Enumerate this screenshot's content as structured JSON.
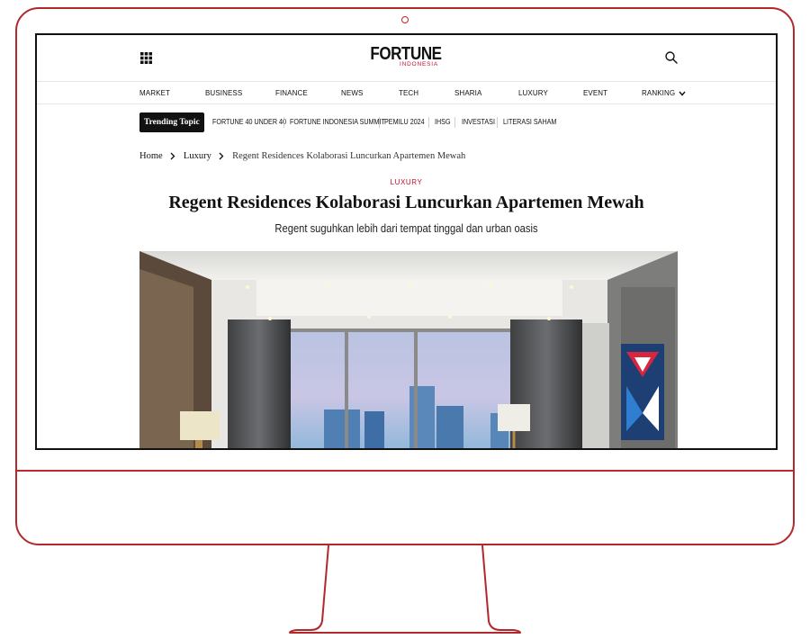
{
  "header": {
    "logo_main": "FORTUNE",
    "logo_sub": "INDONESIA",
    "menu_icon": "grid-menu-icon",
    "search_icon": "search-icon"
  },
  "nav": {
    "items": [
      "MARKET",
      "BUSINESS",
      "FINANCE",
      "NEWS",
      "TECH",
      "SHARIA",
      "LUXURY",
      "EVENT",
      "RANKING"
    ]
  },
  "trending": {
    "label": "Trending Topic",
    "items": [
      "FORTUNE 40 UNDER 40",
      "FORTUNE INDONESIA SUMMIT",
      "PEMILU 2024",
      "IHSG",
      "INVESTASI",
      "LITERASI SAHAM"
    ]
  },
  "breadcrumb": {
    "home": "Home",
    "section": "Luxury",
    "current": "Regent Residences Kolaborasi Luncurkan Apartemen Mewah"
  },
  "article": {
    "category": "LUXURY",
    "title": "Regent Residences Kolaborasi Luncurkan Apartemen Mewah",
    "subtitle": "Regent suguhkan lebih dari tempat tinggal dan urban oasis"
  },
  "colors": {
    "accent": "#c8102e",
    "frame": "#b3282d",
    "text": "#111111"
  }
}
